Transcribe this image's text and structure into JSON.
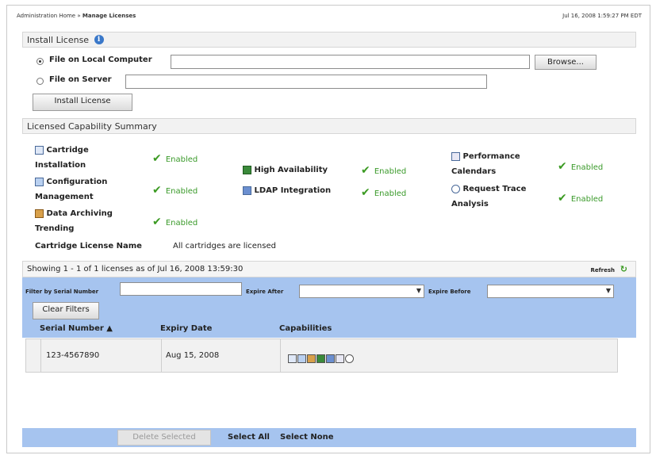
{
  "breadcrumb": {
    "home": "Administration Home",
    "sep": "»",
    "current": "Manage Licenses"
  },
  "timestamp": "Jul 16, 2008 1:59:27 PM EDT",
  "install": {
    "section_title": "Install License",
    "local_label": "File on Local Computer",
    "server_label": "File on Server",
    "local_value": "",
    "server_value": "",
    "browse_label": "Browse...",
    "install_button": "Install License"
  },
  "summary": {
    "section_title": "Licensed Capability Summary",
    "items": [
      {
        "name": "Cartridge Installation",
        "status": "Enabled"
      },
      {
        "name": "Configuration Management",
        "status": "Enabled"
      },
      {
        "name": "Data Archiving Trending",
        "status": "Enabled"
      },
      {
        "name": "High Availability",
        "status": "Enabled"
      },
      {
        "name": "LDAP Integration",
        "status": "Enabled"
      },
      {
        "name": "Performance Calendars",
        "status": "Enabled"
      },
      {
        "name": "Request Trace Analysis",
        "status": "Enabled"
      }
    ],
    "cartridge_label": "Cartridge License Name",
    "cartridge_value": "All cartridges are licensed"
  },
  "licenses": {
    "showing": "Showing 1 - 1  of 1 licenses as of Jul 16, 2008 13:59:30",
    "refresh": "Refresh",
    "filter_serial": "Filter by Serial Number",
    "expire_after": "Expire After",
    "expire_before": "Expire Before",
    "clear_filters": "Clear Filters",
    "columns": [
      "Serial Number ▲",
      "Expiry Date",
      "Capabilities"
    ],
    "rows": [
      {
        "serial": "123-4567890",
        "expiry": "Aug 15, 2008"
      }
    ],
    "delete_selected": "Delete Selected",
    "select_all": "Select All",
    "select_none": "Select None"
  },
  "colors": {
    "enabled": "#3a9a2a",
    "bar": "#a6c4ef"
  }
}
